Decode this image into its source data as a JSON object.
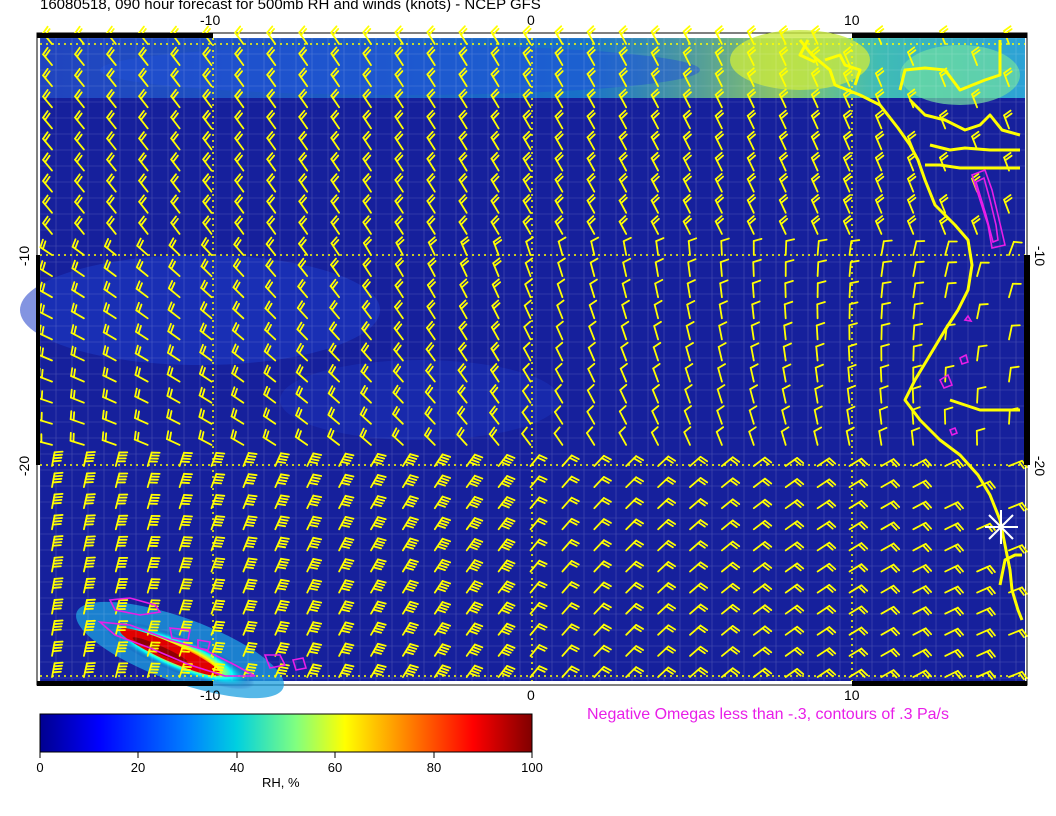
{
  "title": "16080518, 090 hour forecast for 500mb RH and winds (knots) - NCEP GFS",
  "omega_note": "Negative Omegas less than -.3, contours of .3 Pa/s",
  "colorbar": {
    "label": "RH, %",
    "ticks": [
      "0",
      "20",
      "40",
      "60",
      "80",
      "100"
    ],
    "colors": [
      "#00008f",
      "#0000ff",
      "#0080ff",
      "#00ffff",
      "#80ff80",
      "#ffff00",
      "#ff8000",
      "#ff0000",
      "#800000"
    ]
  },
  "axes": {
    "lon_top": [
      "-10",
      "0",
      "10"
    ],
    "lon_bottom": [
      "-10",
      "0",
      "10"
    ],
    "lat_left": [
      "-10",
      "-20"
    ],
    "lat_right": [
      "-10",
      "-20"
    ]
  },
  "colors": {
    "ocean": "#16209c",
    "wind_barbs": "#ffff00",
    "coastline": "#ffff00",
    "omega_contours": "#e81ee8",
    "grid": "#ffffff"
  },
  "icons": {
    "marker": "asterisk-marker-icon"
  }
}
